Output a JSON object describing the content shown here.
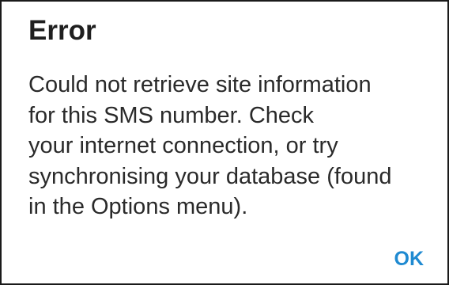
{
  "dialog": {
    "title": "Error",
    "message_lines": [
      "Could not retrieve site information",
      "for this SMS number. Check",
      "your internet connection, or try",
      "synchronising your database (found",
      "in the Options menu)."
    ],
    "ok_label": "OK"
  },
  "colors": {
    "title_text": "#1f1f1f",
    "body_text": "#2a2a2a",
    "accent": "#1f8ad1",
    "border": "#1a1a1a",
    "background": "#ffffff"
  }
}
